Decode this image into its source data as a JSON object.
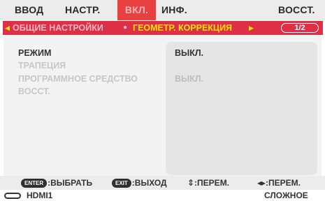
{
  "tabs": [
    {
      "label": "ВВОД",
      "active": false
    },
    {
      "label": "НАСТР.",
      "active": false
    },
    {
      "label": "ВКЛ.",
      "active": true
    },
    {
      "label": "ИНФ.",
      "active": false
    },
    {
      "label": "ВОССТ.",
      "active": false
    }
  ],
  "breadcrumb": {
    "parent": "ОБЩИЕ НАСТРОЙКИ",
    "current": "ГЕОМЕТР. КОРРЕКЦИЯ",
    "page": "1/2"
  },
  "settings": [
    {
      "label": "РЕЖИМ",
      "value": "ВЫКЛ.",
      "enabled": true
    },
    {
      "label": "ТРАПЕЦИЯ",
      "value": "",
      "enabled": false
    },
    {
      "label": "ПРОГРАММНОЕ СРЕДСТВО",
      "value": "ВЫКЛ.",
      "enabled": false
    },
    {
      "label": "ВОССТ.",
      "value": "",
      "enabled": false
    }
  ],
  "hints": {
    "enter_key": "ENTER",
    "enter_label": ":ВЫБРАТЬ",
    "exit_key": "EXIT",
    "exit_label": ":ВЫХОД",
    "updown_label": "⇕:ПЕРЕМ.",
    "leftright_label": "◂▸:ПЕРЕМ."
  },
  "status": {
    "input": "HDMI1",
    "mode": "СЛОЖНОЕ"
  },
  "colors": {
    "accent": "#df2f46",
    "highlight": "#ffe600"
  },
  "icons": [
    "triangle-left-icon",
    "triangle-right-icon",
    "input-connector-icon"
  ]
}
